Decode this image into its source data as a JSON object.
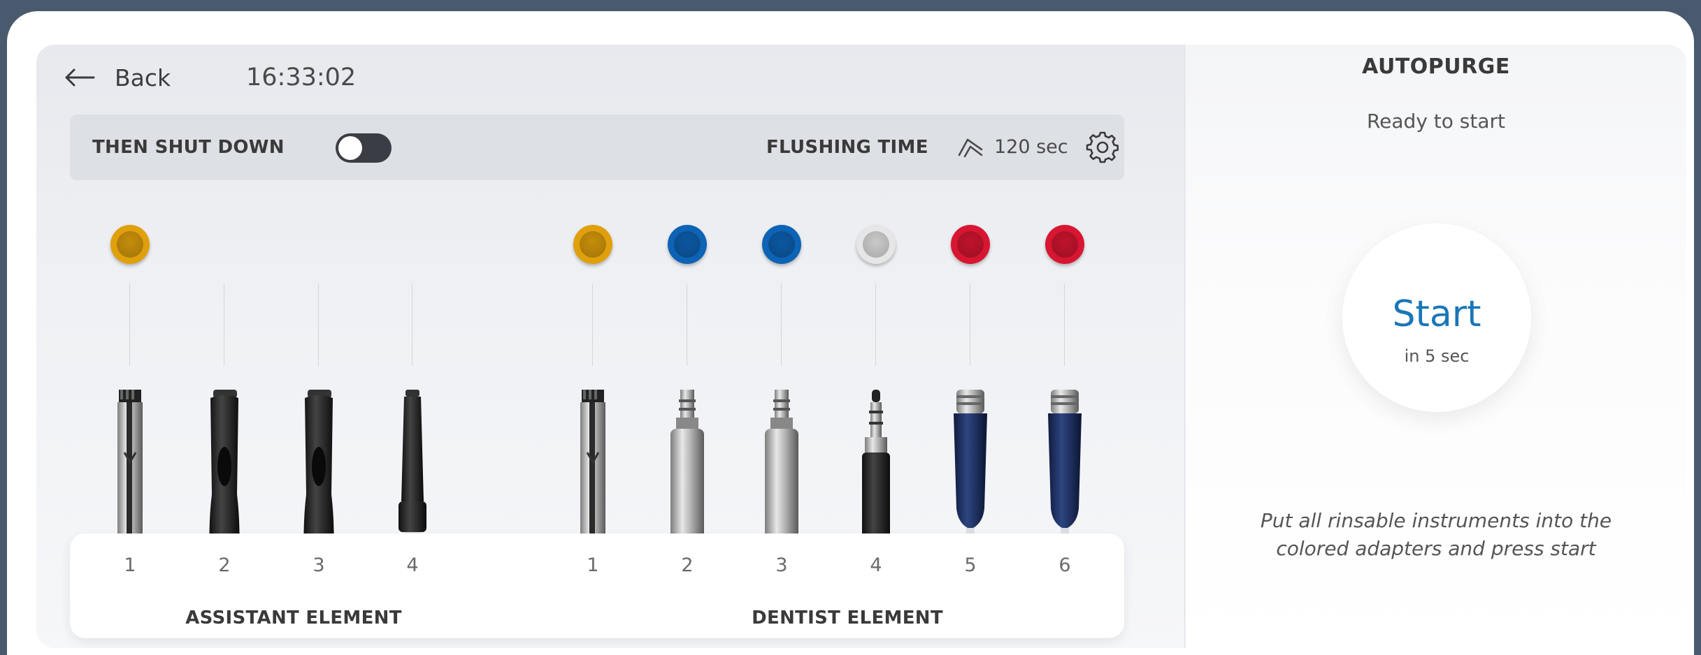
{
  "header": {
    "back_label": "Back",
    "time": "16:33:02"
  },
  "settings_bar": {
    "shutdown_label": "THEN SHUT DOWN",
    "shutdown_enabled": false,
    "flushing_label": "FLUSHING TIME",
    "flushing_value": "120 sec"
  },
  "colors": {
    "gold": "#e0a00c",
    "blue": "#0d63b5",
    "white": "#e6e6e6",
    "red": "#d81632",
    "start_text": "#1a76b7"
  },
  "assistant": {
    "label": "ASSISTANT ELEMENT",
    "slots": [
      {
        "number": "1",
        "adapter_color": "gold",
        "instrument": "suction-cannula"
      },
      {
        "number": "2",
        "adapter_color": "",
        "instrument": "saliva-ejector"
      },
      {
        "number": "3",
        "adapter_color": "",
        "instrument": "saliva-ejector"
      },
      {
        "number": "4",
        "adapter_color": "",
        "instrument": "small-suction-tip"
      }
    ]
  },
  "dentist": {
    "label": "DENTIST ELEMENT",
    "slots": [
      {
        "number": "1",
        "adapter_color": "gold",
        "instrument": "suction-cannula"
      },
      {
        "number": "2",
        "adapter_color": "blue",
        "instrument": "micromotor"
      },
      {
        "number": "3",
        "adapter_color": "blue",
        "instrument": "micromotor"
      },
      {
        "number": "4",
        "adapter_color": "white",
        "instrument": "air-water-syringe"
      },
      {
        "number": "5",
        "adapter_color": "red",
        "instrument": "turbine-coupling"
      },
      {
        "number": "6",
        "adapter_color": "red",
        "instrument": "turbine-coupling"
      }
    ]
  },
  "autopurge": {
    "title": "AUTOPURGE",
    "status": "Ready to start",
    "start_label": "Start",
    "countdown": "in 5 sec",
    "hint_line1": "Put all rinsable instruments into the",
    "hint_line2": "colored adapters and press start"
  }
}
